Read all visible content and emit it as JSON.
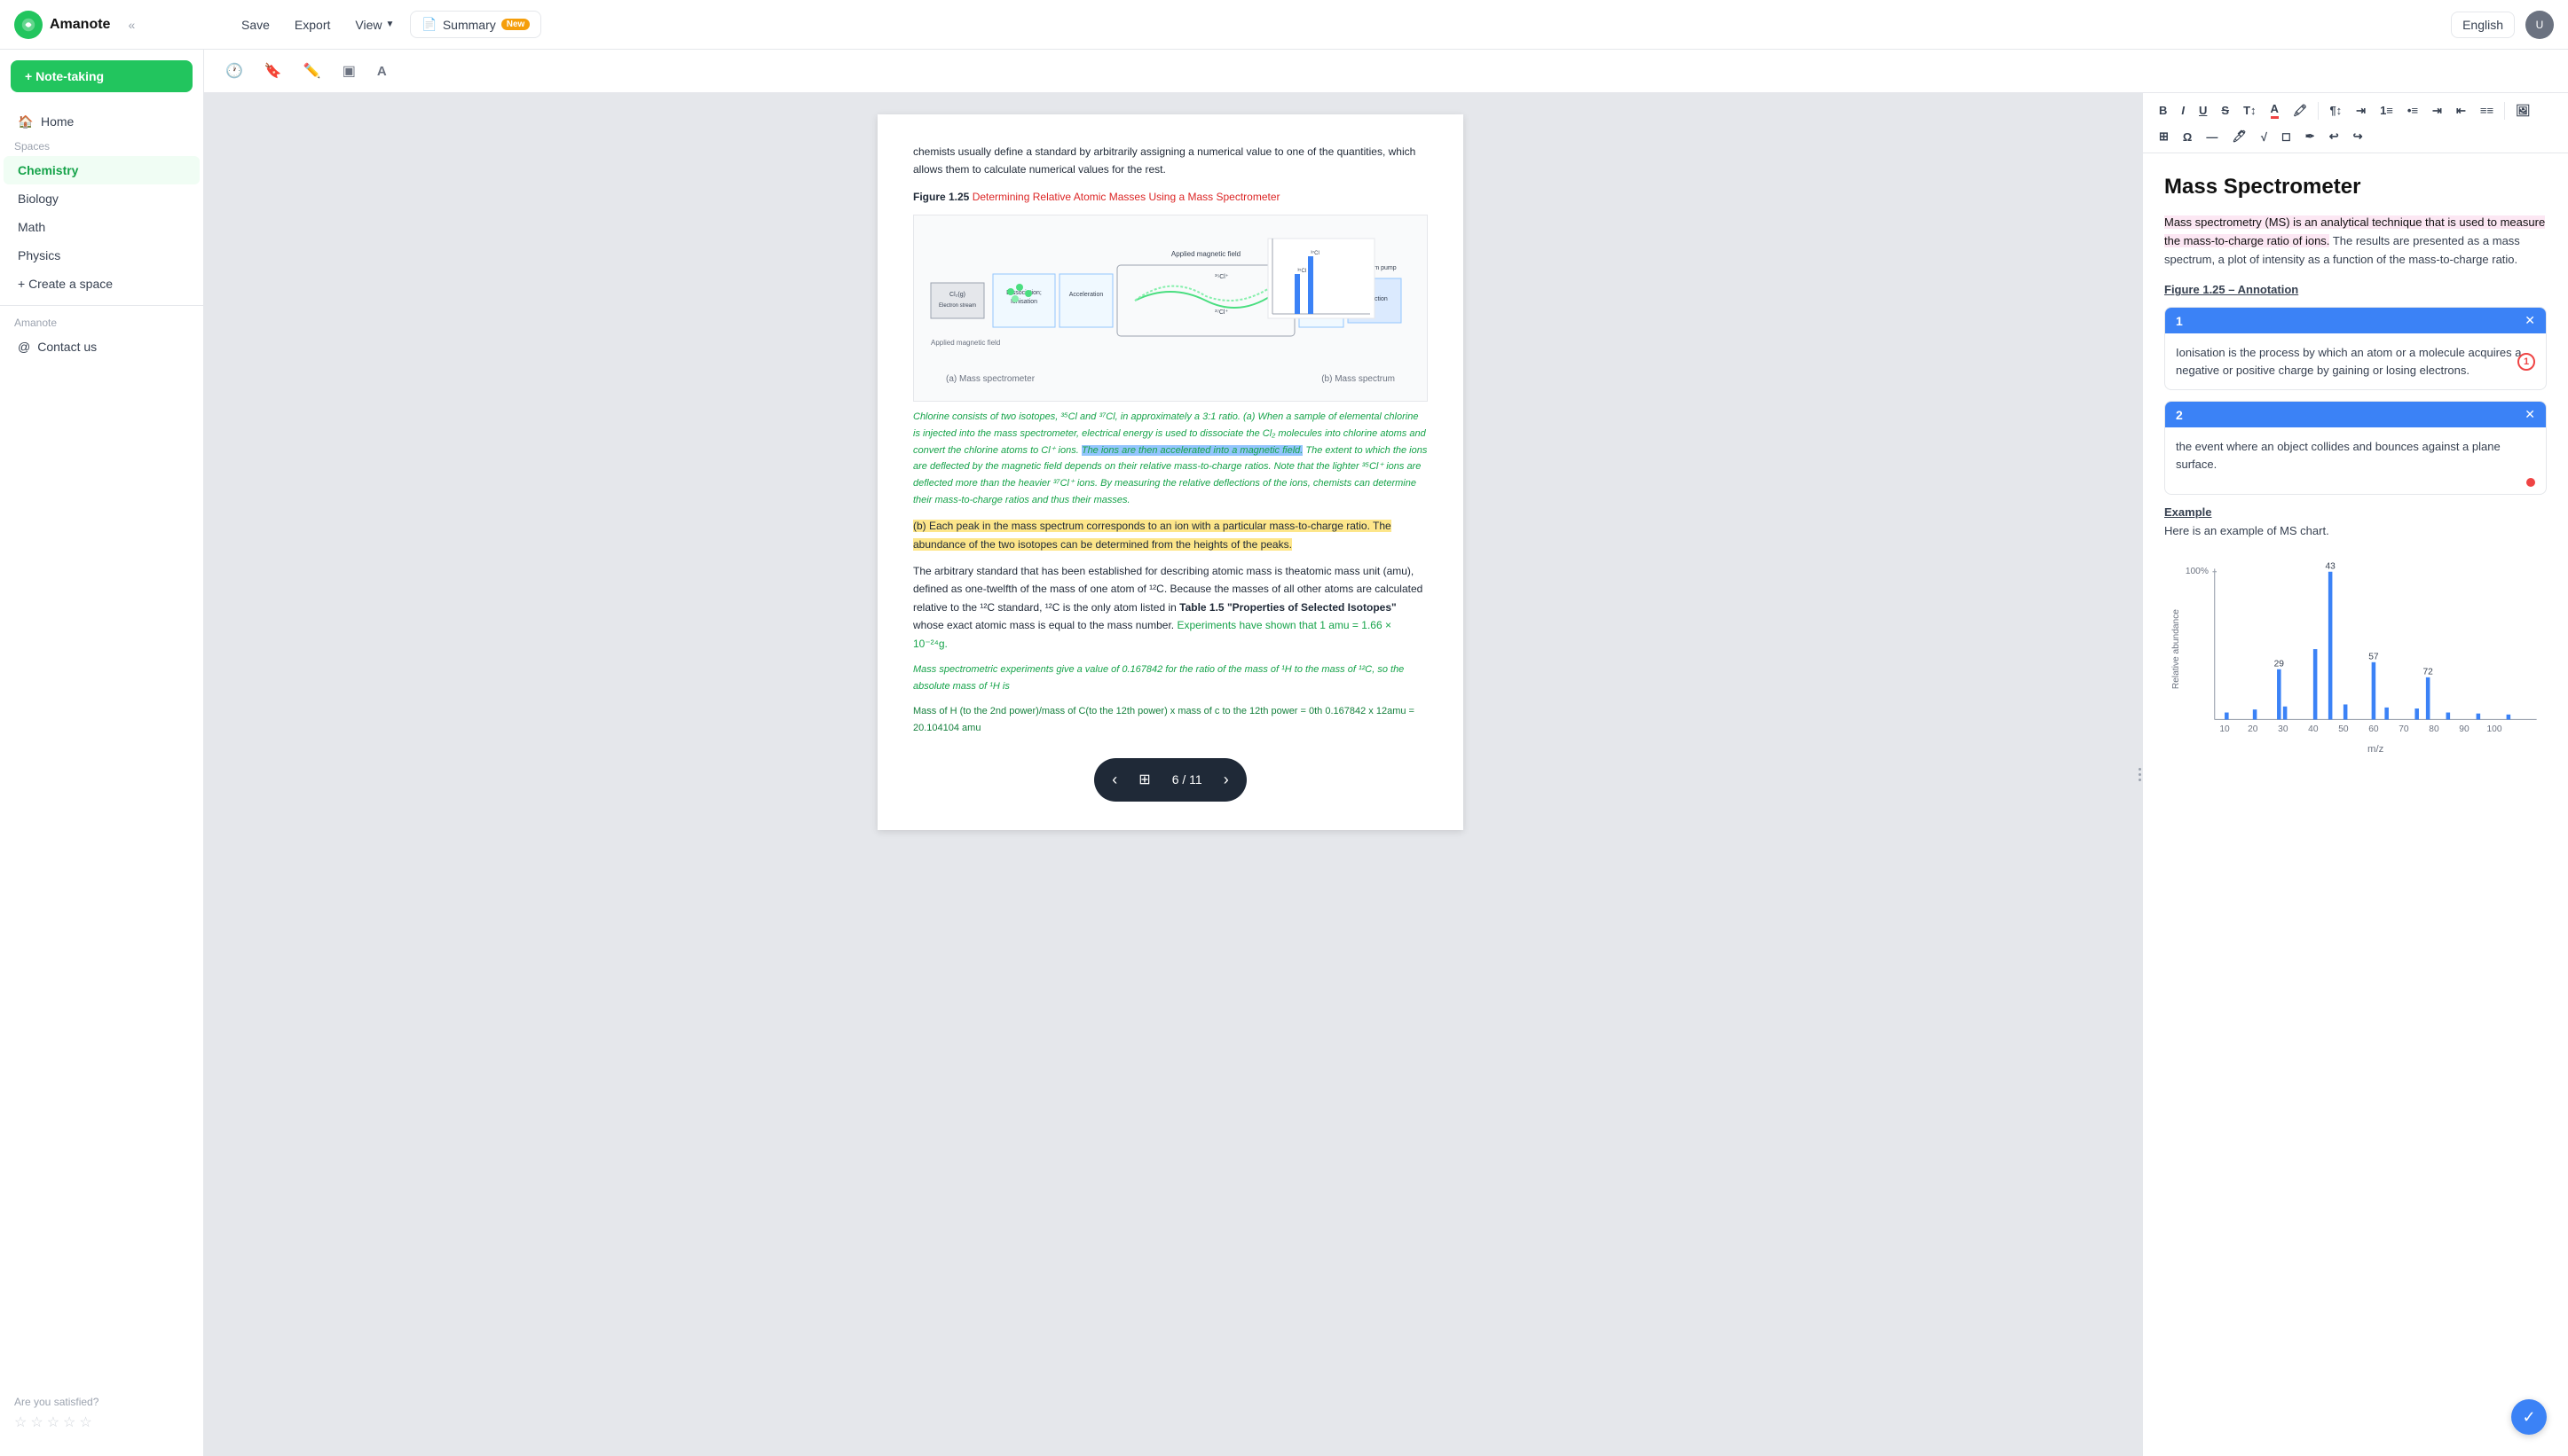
{
  "topbar": {
    "logo": "Amanote",
    "save_label": "Save",
    "export_label": "Export",
    "view_label": "View",
    "summary_label": "Summary",
    "summary_badge": "New",
    "language": "English",
    "collapse_icon": "«"
  },
  "toolbar": {
    "icons": [
      "clock",
      "bookmark",
      "pencil",
      "layers",
      "text"
    ]
  },
  "sidebar": {
    "note_taking_label": "+ Note-taking",
    "spaces_label": "Spaces",
    "home_label": "Home",
    "chemistry_label": "Chemistry",
    "biology_label": "Biology",
    "math_label": "Math",
    "physics_label": "Physics",
    "create_space_label": "+ Create a space",
    "amanote_label": "Amanote",
    "contact_label": "Contact us",
    "satisfaction_label": "Are you satisfied?"
  },
  "pdf": {
    "body_text_1": "chemists usually define a standard by arbitrarily assigning a numerical value to one of the quantities, which allows them to calculate numerical values for the rest.",
    "figure_label": "Figure 1.25",
    "figure_link_text": "Determining Relative Atomic Masses Using a Mass Spectrometer",
    "fig_caption_a": "(a) Mass spectrometer",
    "fig_caption_b": "(b) Mass spectrum",
    "green_text_1": "Chlorine consists of two isotopes, ³⁵Cl and ³⁷Cl, in approximately a 3:1 ratio.",
    "green_text_2": " (a) When a sample of elemental chlorine is injected into the mass spectrometer, electrical energy is used to dissociate the Cl₂ molecules into chlorine atoms and convert the chlorine atoms to Cl⁺ ions.",
    "blue_text": "The ions are then accelerated into a magnetic field.",
    "body_text_2": " The extent to which the ions are deflected by the magnetic field depends on their relative mass-to-charge ratios. Note that the lighter ³⁵Cl⁺ ions are deflected more than the heavier ³⁷Cl⁺ ions. By measuring the relative deflections of the ions, chemists can determine their mass-to-charge ratios and thus their masses.",
    "yellow_text": "(b) Each peak in the mass spectrum corresponds to an ion with a particular mass-to-charge ratio. The abundance of the two isotopes can be determined from the heights of the peaks.",
    "body_text_3": "The arbitrary standard that has been established for describing atomic mass is theatomic mass unit (amu), defined as one-twelfth of the mass of one atom of ¹²C. Because the masses of all other atoms are calculated relative to the ¹²C standard, ¹²C is the only atom listed in",
    "table_ref": "Table 1.5 \"Properties of Selected Isotopes\"",
    "body_text_4": "whose exact atomic mass is equal to the mass number.",
    "green_highlight_text": "Experiments have shown that 1 amu = 1.66 × 10⁻²⁴g.",
    "body_text_5": "Mass spectrometric experiments give a value of 0.167842 for the ratio of the mass of ¹H to the mass of ¹²C, so the absolute mass of ¹H is",
    "math_text": "Mass of H (to the 2nd power)/mass of C(to the 12th power) x mass of c to the 12th power = 0th 0.167842 x 12amu = 20.104104 amu",
    "page_current": "6",
    "page_total": "11"
  },
  "notes": {
    "title": "Mass Spectrometer",
    "pink_text": "Mass spectrometry (MS) is an analytical technique that is used to measure the mass-to-charge ratio of ions.",
    "body_text": " The results are presented as a mass spectrum, a plot of intensity as a function of the mass-to-charge ratio.",
    "figure_annotation_label": "Figure 1.25 – Annotation",
    "annotation_1_num": "1",
    "annotation_1_text": "Ionisation is the process by which an atom or a molecule acquires a negative or positive charge by gaining or losing electrons.",
    "annotation_2_num": "2",
    "annotation_2_text": "the event where an object collides and bounces against a plane surface.",
    "example_label": "Example",
    "example_text": "Here is an example of MS chart.",
    "chart": {
      "y_label": "Relative abundance",
      "x_label": "m/z",
      "y_max": "100%",
      "bars": [
        {
          "x": 10,
          "height": 5,
          "label": ""
        },
        {
          "x": 20,
          "height": 8,
          "label": ""
        },
        {
          "x": 29,
          "height": 35,
          "label": "29"
        },
        {
          "x": 30,
          "height": 10,
          "label": ""
        },
        {
          "x": 40,
          "height": 55,
          "label": ""
        },
        {
          "x": 43,
          "height": 100,
          "label": "43"
        },
        {
          "x": 50,
          "height": 12,
          "label": ""
        },
        {
          "x": 57,
          "height": 40,
          "label": "57"
        },
        {
          "x": 60,
          "height": 8,
          "label": ""
        },
        {
          "x": 70,
          "height": 8,
          "label": ""
        },
        {
          "x": 72,
          "height": 30,
          "label": "72"
        },
        {
          "x": 80,
          "height": 5,
          "label": ""
        },
        {
          "x": 90,
          "height": 4,
          "label": ""
        },
        {
          "x": 100,
          "height": 3,
          "label": ""
        }
      ],
      "x_ticks": [
        "10",
        "20",
        "30",
        "40",
        "50",
        "60",
        "70",
        "80",
        "90",
        "100"
      ]
    }
  }
}
